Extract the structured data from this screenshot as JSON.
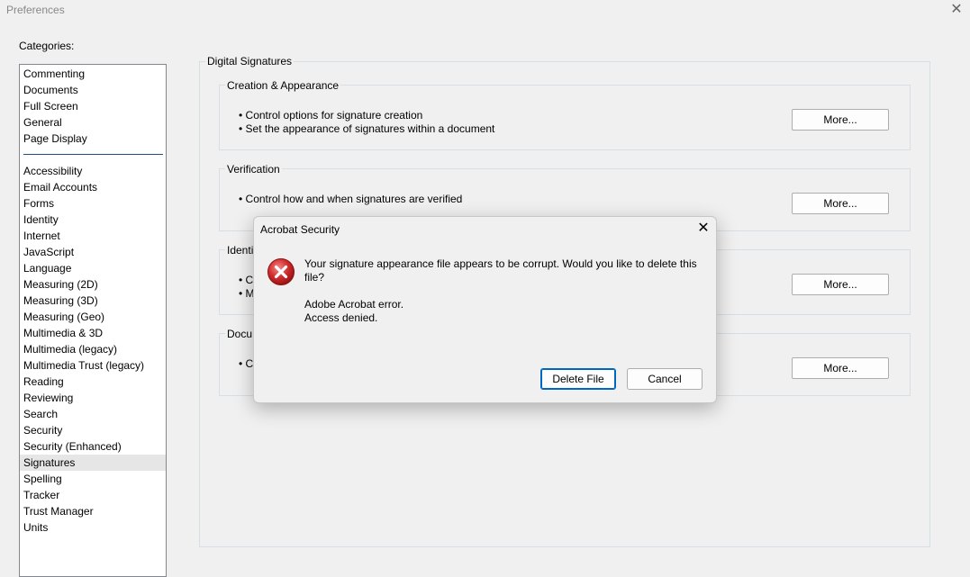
{
  "window": {
    "title": "Preferences",
    "close_glyph": "✕"
  },
  "categories": {
    "label": "Categories:",
    "group1": [
      "Commenting",
      "Documents",
      "Full Screen",
      "General",
      "Page Display"
    ],
    "group2": [
      "Accessibility",
      "Email Accounts",
      "Forms",
      "Identity",
      "Internet",
      "JavaScript",
      "Language",
      "Measuring (2D)",
      "Measuring (3D)",
      "Measuring (Geo)",
      "Multimedia & 3D",
      "Multimedia (legacy)",
      "Multimedia Trust (legacy)",
      "Reading",
      "Reviewing",
      "Search",
      "Security",
      "Security (Enhanced)",
      "Signatures",
      "Spelling",
      "Tracker",
      "Trust Manager",
      "Units"
    ],
    "selected": "Signatures"
  },
  "panel": {
    "title": "Digital Signatures",
    "sections": [
      {
        "title": "Creation & Appearance",
        "bullets": [
          "• Control options for signature creation",
          "• Set the appearance of signatures within a document"
        ],
        "button": "More..."
      },
      {
        "title": "Verification",
        "bullets": [
          "• Control how and when signatures are verified"
        ],
        "button": "More..."
      },
      {
        "title": "Identi",
        "bullets": [
          "• C",
          "• M"
        ],
        "button": "More..."
      },
      {
        "title": "Docu",
        "bullets": [
          "• C"
        ],
        "button": "More..."
      }
    ]
  },
  "dialog": {
    "title": "Acrobat Security",
    "close_glyph": "✕",
    "icon": "error-icon",
    "message": "Your signature appearance file appears to be corrupt. Would you like to delete this file?",
    "error_line1": "Adobe Acrobat error.",
    "error_line2": "Access denied.",
    "delete_label": "Delete File",
    "cancel_label": "Cancel"
  },
  "colors": {
    "error_red": "#d32f2f",
    "default_button_border": "#0067c0",
    "selected_item": "#e6e6e6"
  }
}
